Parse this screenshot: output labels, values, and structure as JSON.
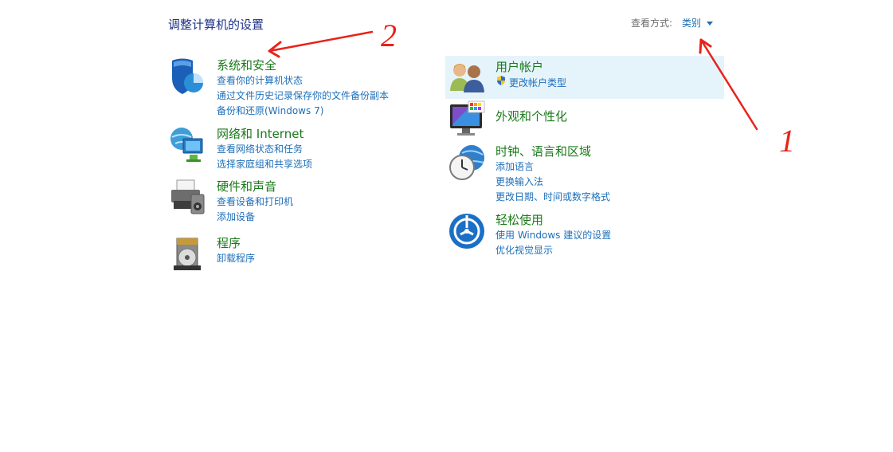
{
  "page": {
    "title": "调整计算机的设置"
  },
  "view_by": {
    "label": "查看方式:",
    "value": "类别"
  },
  "left": [
    {
      "title": "系统和安全",
      "links": [
        "查看你的计算机状态",
        "通过文件历史记录保存你的文件备份副本",
        "备份和还原(Windows 7)"
      ],
      "icon": "security-shield-icon"
    },
    {
      "title": "网络和 Internet",
      "links": [
        "查看网络状态和任务",
        "选择家庭组和共享选项"
      ],
      "icon": "network-globe-icon"
    },
    {
      "title": "硬件和声音",
      "links": [
        "查看设备和打印机",
        "添加设备"
      ],
      "icon": "printer-icon"
    },
    {
      "title": "程序",
      "links": [
        "卸载程序"
      ],
      "icon": "programs-disc-icon"
    }
  ],
  "right": [
    {
      "title": "用户帐户",
      "links": [
        "更改帐户类型"
      ],
      "icon": "users-icon",
      "highlighted": true
    },
    {
      "title": "外观和个性化",
      "links": [],
      "icon": "monitor-palette-icon"
    },
    {
      "title": "时钟、语言和区域",
      "links": [
        "添加语言",
        "更换输入法",
        "更改日期、时间或数字格式"
      ],
      "icon": "clock-globe-icon"
    },
    {
      "title": "轻松使用",
      "links": [
        "使用 Windows 建议的设置",
        "优化视觉显示"
      ],
      "icon": "ease-of-access-icon"
    }
  ],
  "annotations": {
    "mark_1": "1",
    "mark_2": "2",
    "color": "#e8231a"
  }
}
